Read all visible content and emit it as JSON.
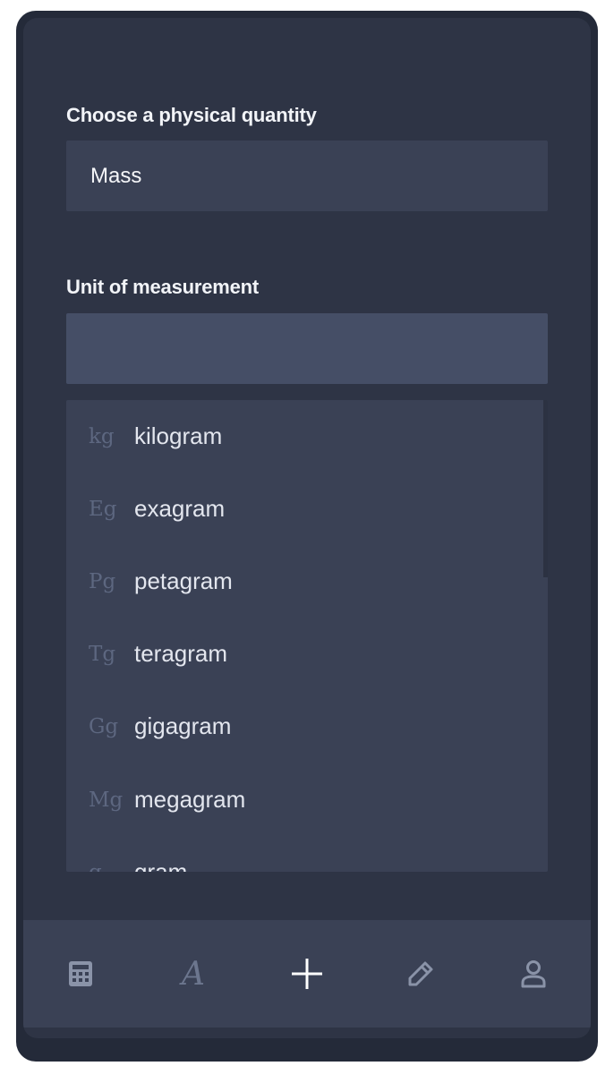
{
  "quantity": {
    "label": "Choose a physical quantity",
    "selected": "Mass"
  },
  "unit": {
    "label": "Unit of measurement",
    "input_value": "",
    "items": [
      {
        "symbol": "kg",
        "name": "kilogram"
      },
      {
        "symbol": "Eg",
        "name": "exagram"
      },
      {
        "symbol": "Pg",
        "name": "petagram"
      },
      {
        "symbol": "Tg",
        "name": "teragram"
      },
      {
        "symbol": "Gg",
        "name": "gigagram"
      },
      {
        "symbol": "Mg",
        "name": "megagram"
      },
      {
        "symbol": "g",
        "name": "gram"
      }
    ]
  },
  "nav": {
    "calculator_icon": "calculator-icon",
    "font_icon": "font-a-icon",
    "font_glyph": "A",
    "add_icon": "plus-icon",
    "edit_icon": "pencil-icon",
    "profile_icon": "user-icon"
  },
  "colors": {
    "frame": "#242a39",
    "screen": "#2e3445",
    "field": "#3a4155",
    "field_active": "#454e66",
    "text": "#f2f4f8",
    "symbol": "#5d6780",
    "icon_muted": "#8a93a8",
    "icon_active": "#ffffff"
  }
}
